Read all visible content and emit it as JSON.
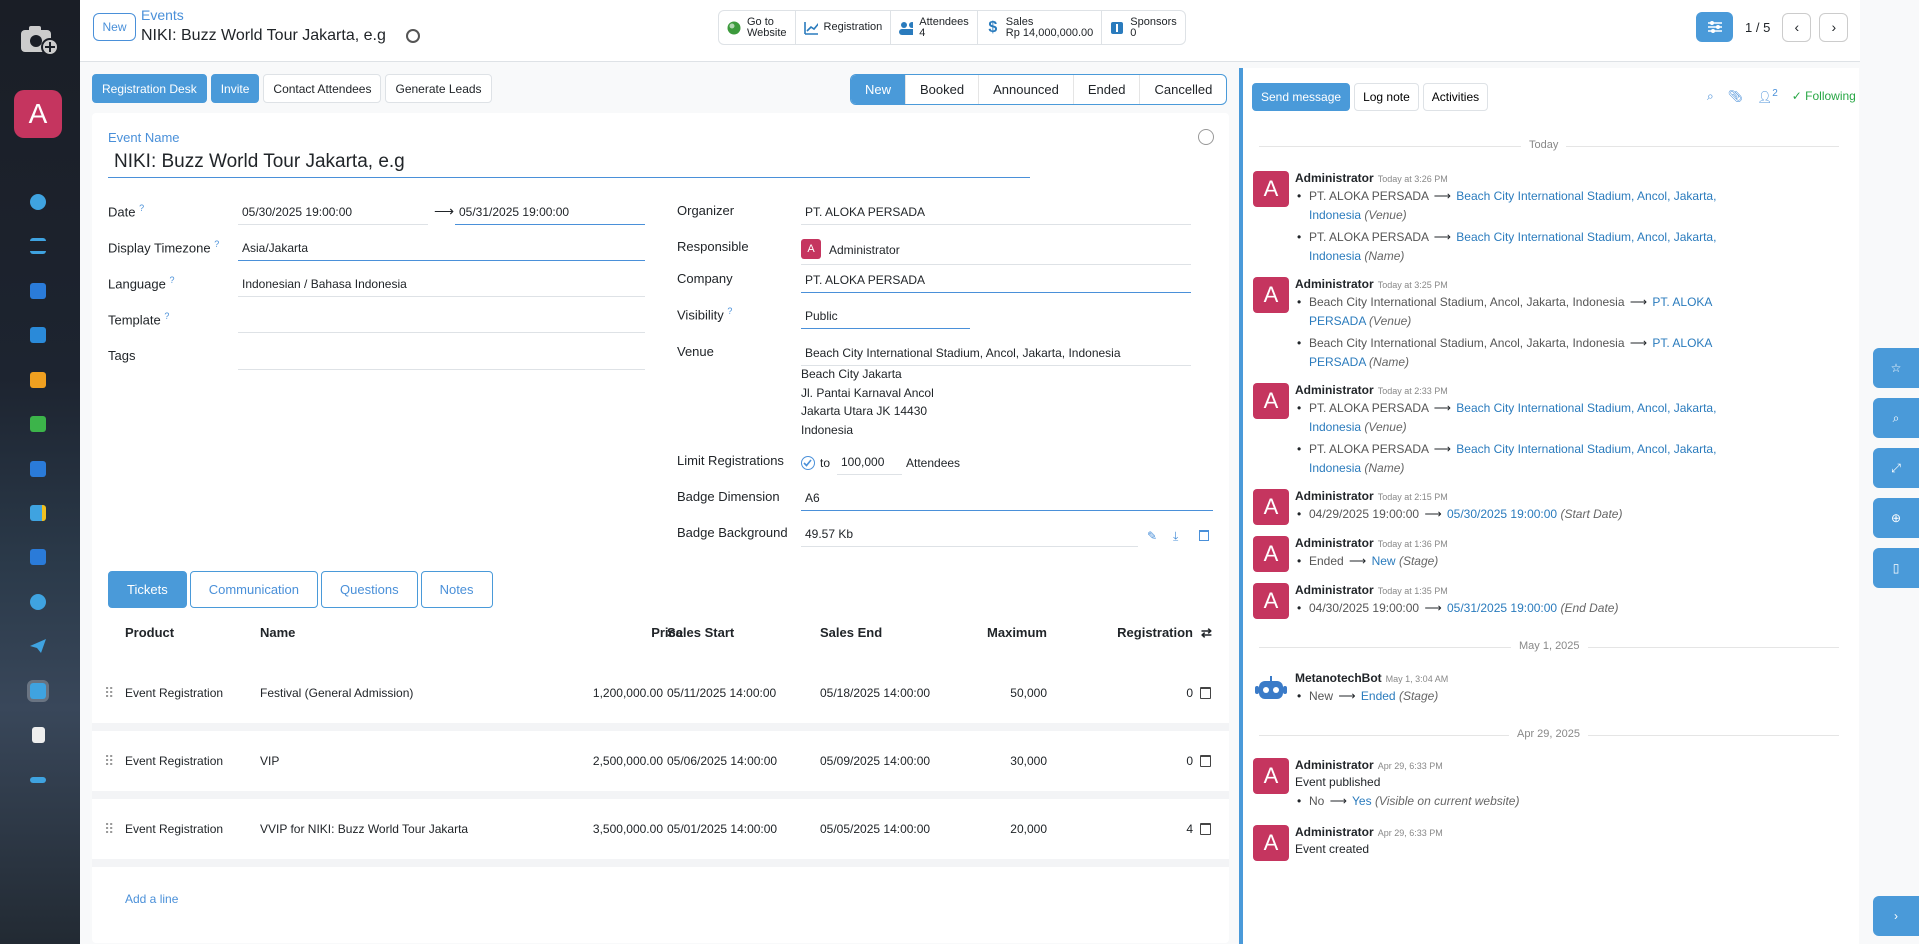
{
  "sidebar": {
    "avatar": "A"
  },
  "header": {
    "new_label": "New",
    "breadcrumb": "Events",
    "title": "NIKI: Buzz World Tour Jakarta, e.g"
  },
  "stats": [
    {
      "l1": "Go to",
      "l2": "Website",
      "icon": "globe-icon"
    },
    {
      "l1": "Registration",
      "l2": "",
      "icon": "chart-icon"
    },
    {
      "l1": "Attendees",
      "l2": "4",
      "icon": "users-icon"
    },
    {
      "l1": "Sales",
      "l2": "Rp 14,000,000.00",
      "icon": "dollar-icon"
    },
    {
      "l1": "Sponsors",
      "l2": "0",
      "icon": "sponsor-icon"
    }
  ],
  "pager": {
    "count": "1 / 5"
  },
  "actions": {
    "registration_desk": "Registration Desk",
    "invite": "Invite",
    "contact": "Contact Attendees",
    "leads": "Generate Leads"
  },
  "stages": [
    "New",
    "Booked",
    "Announced",
    "Ended",
    "Cancelled"
  ],
  "form": {
    "event_name_label": "Event Name",
    "event_name": "NIKI: Buzz World Tour Jakarta, e.g",
    "date_label": "Date",
    "date_start": "05/30/2025 19:00:00",
    "date_end": "05/31/2025 19:00:00",
    "tz_label": "Display Timezone",
    "tz": "Asia/Jakarta",
    "lang_label": "Language",
    "lang": "Indonesian / Bahasa Indonesia",
    "template_label": "Template",
    "tags_label": "Tags",
    "organizer_label": "Organizer",
    "organizer": "PT. ALOKA PERSADA",
    "responsible_label": "Responsible",
    "responsible": "Administrator",
    "company_label": "Company",
    "company": "PT. ALOKA PERSADA",
    "visibility_label": "Visibility",
    "visibility": "Public",
    "venue_label": "Venue",
    "venue": "Beach City International Stadium, Ancol, Jakarta, Indonesia",
    "address": [
      "Beach City Jakarta",
      "Jl. Pantai Karnaval Ancol",
      "Jakarta Utara JK 14430",
      "Indonesia"
    ],
    "limit_label": "Limit Registrations",
    "limit_to": "to",
    "limit_value": "100,000",
    "limit_unit": "Attendees",
    "badge_dim_label": "Badge Dimension",
    "badge_dim": "A6",
    "badge_bg_label": "Badge Background",
    "badge_bg": "49.57 Kb"
  },
  "tabs": [
    "Tickets",
    "Communication",
    "Questions",
    "Notes"
  ],
  "table": {
    "headers": {
      "product": "Product",
      "name": "Name",
      "price": "Price",
      "start": "Sales Start",
      "end": "Sales End",
      "max": "Maximum",
      "reg": "Registration"
    },
    "rows": [
      {
        "product": "Event Registration",
        "name": "Festival (General Admission)",
        "price": "1,200,000.00",
        "start": "05/11/2025 14:00:00",
        "end": "05/18/2025 14:00:00",
        "max": "50,000",
        "reg": "0"
      },
      {
        "product": "Event Registration",
        "name": "VIP",
        "price": "2,500,000.00",
        "start": "05/06/2025 14:00:00",
        "end": "05/09/2025 14:00:00",
        "max": "30,000",
        "reg": "0"
      },
      {
        "product": "Event Registration",
        "name": "VVIP for NIKI: Buzz World Tour Jakarta",
        "price": "3,500,000.00",
        "start": "05/01/2025 14:00:00",
        "end": "05/05/2025 14:00:00",
        "max": "20,000",
        "reg": "4"
      }
    ],
    "add_line": "Add a line"
  },
  "chatter": {
    "send": "Send message",
    "log": "Log note",
    "activities": "Activities",
    "followers": "2",
    "following": "Following",
    "sep_today": "Today",
    "sep_may1": "May 1, 2025",
    "sep_apr29": "Apr 29, 2025",
    "m1": {
      "author": "Administrator",
      "time": "Today at 3:26 PM",
      "a_old": "PT. ALOKA PERSADA",
      "a_new": "Beach City International Stadium, Ancol, Jakarta, Indonesia",
      "a_field": "(Venue)",
      "b_old": "PT. ALOKA PERSADA",
      "b_new": "Beach City International Stadium, Ancol, Jakarta, Indonesia",
      "b_field": "(Name)"
    },
    "m2": {
      "author": "Administrator",
      "time": "Today at 3:25 PM",
      "a_old": "Beach City International Stadium, Ancol, Jakarta, Indonesia",
      "a_new": "PT. ALOKA PERSADA",
      "a_field": "(Venue)",
      "b_old": "Beach City International Stadium, Ancol, Jakarta, Indonesia",
      "b_new": "PT. ALOKA PERSADA",
      "b_field": "(Name)"
    },
    "m3": {
      "author": "Administrator",
      "time": "Today at 2:33 PM",
      "a_old": "PT. ALOKA PERSADA",
      "a_new": "Beach City International Stadium, Ancol, Jakarta, Indonesia",
      "a_field": "(Venue)",
      "b_old": "PT. ALOKA PERSADA",
      "b_new": "Beach City International Stadium, Ancol, Jakarta, Indonesia",
      "b_field": "(Name)"
    },
    "m4": {
      "author": "Administrator",
      "time": "Today at 2:15 PM",
      "old": "04/29/2025 19:00:00",
      "new": "05/30/2025 19:00:00",
      "field": "(Start Date)"
    },
    "m5": {
      "author": "Administrator",
      "time": "Today at 1:36 PM",
      "old": "Ended",
      "new": "New",
      "field": "(Stage)"
    },
    "m6": {
      "author": "Administrator",
      "time": "Today at 1:35 PM",
      "old": "04/30/2025 19:00:00",
      "new": "05/31/2025 19:00:00",
      "field": "(End Date)"
    },
    "m7": {
      "author": "MetanotechBot",
      "time": "May 1, 3:04 AM",
      "old": "New",
      "new": "Ended",
      "field": "(Stage)"
    },
    "m8": {
      "author": "Administrator",
      "time": "Apr 29, 6:33 PM",
      "body": "Event published",
      "old": "No",
      "new": "Yes",
      "field": "(Visible on current website)"
    },
    "m9": {
      "author": "Administrator",
      "time": "Apr 29, 6:33 PM",
      "body": "Event created"
    },
    "avatar": "A"
  },
  "colors": {
    "primary": "#4a9ad9",
    "avatar": "#c5355f",
    "link": "#2a7bbd",
    "following": "#28a745"
  }
}
